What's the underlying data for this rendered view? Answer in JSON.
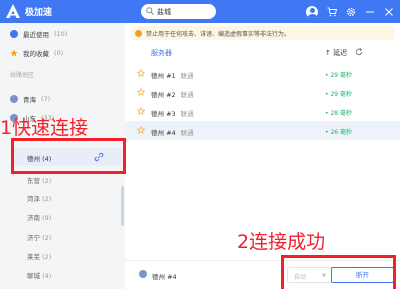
{
  "app": {
    "name": "极加速"
  },
  "search": {
    "value": "盐城"
  },
  "sidebar": {
    "items": [
      {
        "label": "最近使用",
        "count": "(10)"
      },
      {
        "label": "我的收藏",
        "count": "(0)"
      }
    ],
    "section_label": "线路地区",
    "regions": [
      {
        "label": "青海",
        "count": "(7)"
      },
      {
        "label": "山东",
        "count": "(33)"
      }
    ],
    "selected_city": {
      "label": "德州",
      "count": "(4)"
    },
    "cities": [
      {
        "label": "东营",
        "count": "(2)"
      },
      {
        "label": "菏泽",
        "count": "(2)"
      },
      {
        "label": "济南",
        "count": "(9)"
      },
      {
        "label": "济宁",
        "count": "(2)"
      },
      {
        "label": "莱芜",
        "count": "(2)"
      },
      {
        "label": "聊城",
        "count": "(4)"
      }
    ]
  },
  "notice": {
    "text": "禁止用于任何攻击、诽谤、编造虚假事实等非法行为。"
  },
  "table": {
    "col_server": "服务器",
    "col_latency": "延迟",
    "rows": [
      {
        "name": "德州 #1",
        "tag": "联通",
        "latency": "29 毫秒"
      },
      {
        "name": "德州 #2",
        "tag": "联通",
        "latency": "29 毫秒"
      },
      {
        "name": "德州 #3",
        "tag": "联通",
        "latency": "28 毫秒"
      },
      {
        "name": "德州 #4",
        "tag": "联通",
        "latency": "26 毫秒"
      }
    ]
  },
  "bottom": {
    "current_server": "德州 #4",
    "mode_value": "自动",
    "disconnect_label": "断开"
  },
  "annotations": {
    "step1": "1快速连接",
    "step2": "2连接成功"
  },
  "colors": {
    "accent": "#3f78f2",
    "latency_ok": "#19b36a",
    "annotation_red": "#f3202b"
  }
}
